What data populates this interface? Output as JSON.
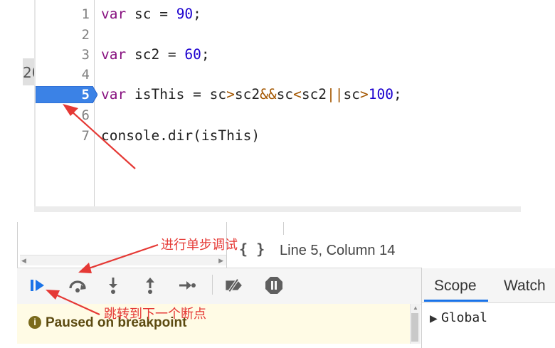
{
  "editor": {
    "left_tab_text": "20",
    "lines": [
      {
        "num": "1",
        "tokens": [
          {
            "t": "var",
            "c": "kw"
          },
          {
            "t": " sc = ",
            "c": "plain"
          },
          {
            "t": "90",
            "c": "num"
          },
          {
            "t": ";",
            "c": "plain"
          }
        ]
      },
      {
        "num": "2",
        "tokens": []
      },
      {
        "num": "3",
        "tokens": [
          {
            "t": "var",
            "c": "kw"
          },
          {
            "t": " sc2 = ",
            "c": "plain"
          },
          {
            "t": "60",
            "c": "num"
          },
          {
            "t": ";",
            "c": "plain"
          }
        ]
      },
      {
        "num": "4",
        "tokens": []
      },
      {
        "num": "5",
        "tokens": [
          {
            "t": "var",
            "c": "kw"
          },
          {
            "t": " isThis = sc",
            "c": "plain"
          },
          {
            "t": ">",
            "c": "op"
          },
          {
            "t": "sc2",
            "c": "plain"
          },
          {
            "t": "&&",
            "c": "op"
          },
          {
            "t": "sc",
            "c": "plain"
          },
          {
            "t": "<",
            "c": "op"
          },
          {
            "t": "sc2",
            "c": "plain"
          },
          {
            "t": "||",
            "c": "op"
          },
          {
            "t": "sc",
            "c": "plain"
          },
          {
            "t": ">",
            "c": "op"
          },
          {
            "t": "100",
            "c": "num"
          },
          {
            "t": ";",
            "c": "plain"
          }
        ]
      },
      {
        "num": "6",
        "tokens": []
      },
      {
        "num": "7",
        "tokens": [
          {
            "t": "console.dir(isThis)",
            "c": "plain"
          }
        ]
      }
    ],
    "breakpoint_line": "5"
  },
  "status_bar": {
    "pretty_print_icon": "{ }",
    "cursor_position": "Line 5, Column 14"
  },
  "toolbar": {
    "buttons": [
      {
        "name": "resume-button",
        "icon": "resume-icon"
      },
      {
        "name": "step-over-button",
        "icon": "step-over-icon"
      },
      {
        "name": "step-into-button",
        "icon": "step-into-icon"
      },
      {
        "name": "step-out-button",
        "icon": "step-out-icon"
      },
      {
        "name": "step-button",
        "icon": "step-icon"
      },
      {
        "name": "deactivate-breakpoints-button",
        "icon": "deactivate-breakpoints-icon"
      },
      {
        "name": "pause-on-exceptions-button",
        "icon": "pause-on-exceptions-icon"
      }
    ]
  },
  "paused_banner": {
    "icon": "info-icon",
    "icon_glyph": "i",
    "text": "Paused on breakpoint"
  },
  "right_panel": {
    "tabs": [
      "Scope",
      "Watch"
    ],
    "active_tab": "Scope",
    "tree": [
      {
        "arrow": "▶",
        "label": "Global"
      }
    ]
  },
  "annotations": {
    "step_label": "进行单步调试",
    "resume_label": "跳转到下一个断点",
    "arrow_color": "#e53935"
  },
  "colors": {
    "breakpoint_blue": "#3b82e6",
    "accent_blue": "#1a73e8",
    "banner_bg": "#fffbe5"
  }
}
